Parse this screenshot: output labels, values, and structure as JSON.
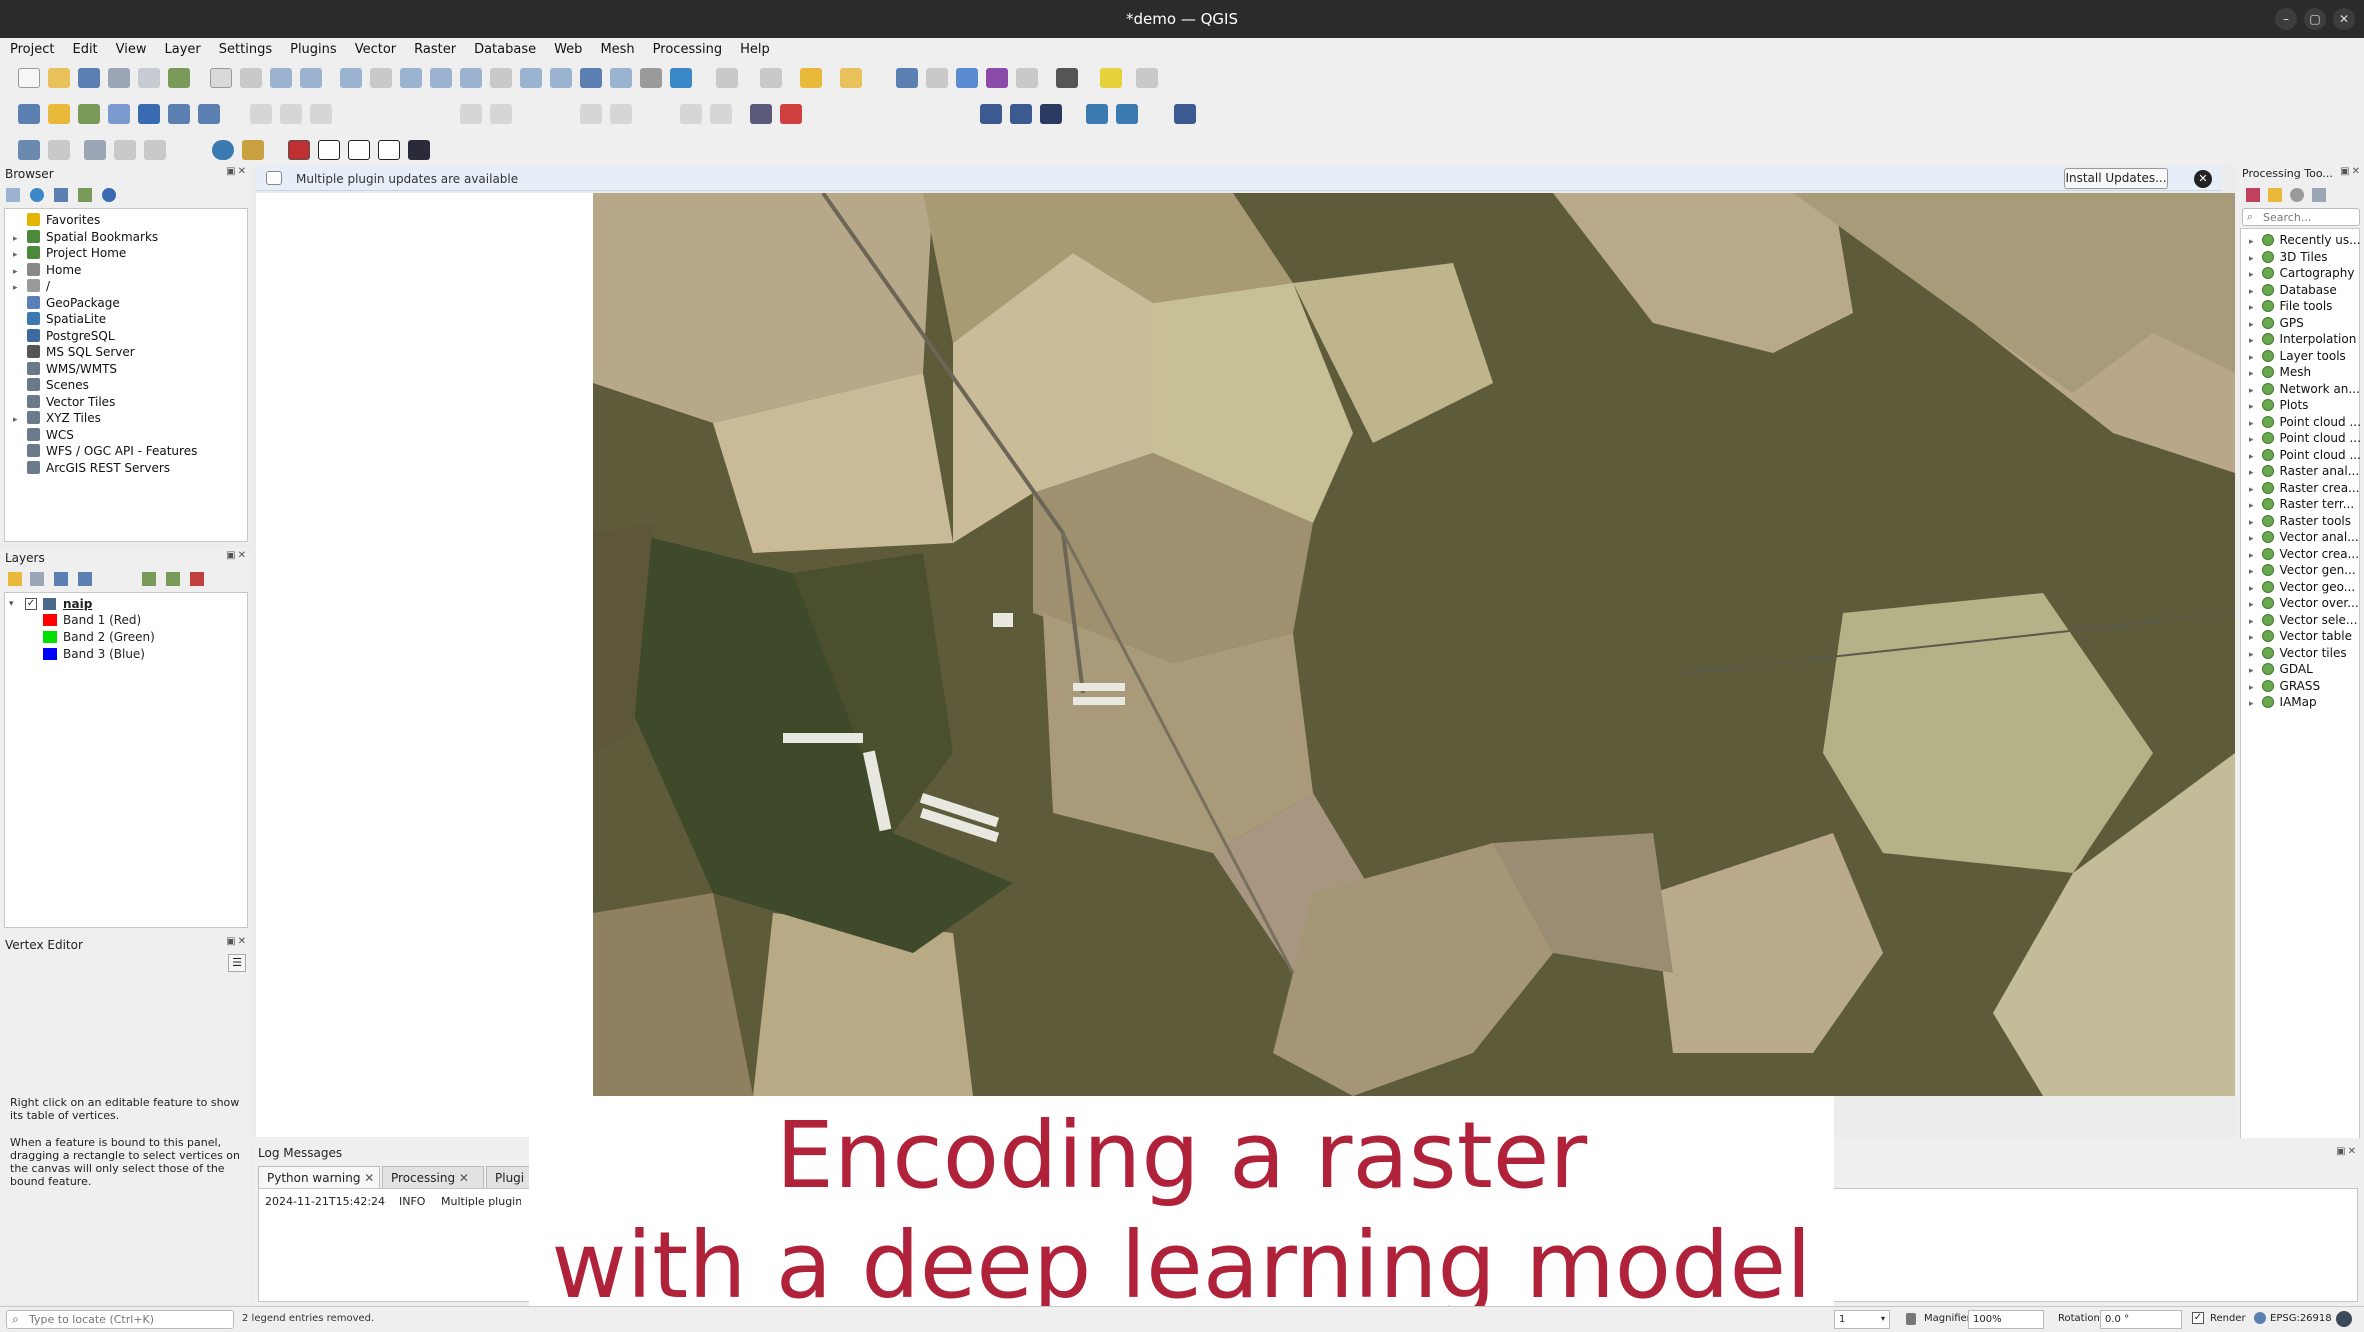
{
  "window": {
    "title": "*demo — QGIS",
    "controls": [
      "–",
      "▢",
      "✕"
    ]
  },
  "menu": [
    "Project",
    "Edit",
    "View",
    "Layer",
    "Settings",
    "Plugins",
    "Vector",
    "Raster",
    "Database",
    "Web",
    "Mesh",
    "Processing",
    "Help"
  ],
  "browser": {
    "title": "Browser",
    "items": [
      {
        "label": "Favorites",
        "arrow": "",
        "icon": "star-icon",
        "color": "#e5b400"
      },
      {
        "label": "Spatial Bookmarks",
        "arrow": "▸",
        "icon": "bookmark-icon",
        "color": "#4a8a3a"
      },
      {
        "label": "Project Home",
        "arrow": "▸",
        "icon": "project-home-icon",
        "color": "#4a8a3a"
      },
      {
        "label": "Home",
        "arrow": "▸",
        "icon": "home-icon",
        "color": "#888888"
      },
      {
        "label": "/",
        "arrow": "▸",
        "icon": "folder-icon",
        "color": "#9a9a9a"
      },
      {
        "label": "GeoPackage",
        "arrow": "",
        "icon": "geopackage-icon",
        "color": "#5b7fb8"
      },
      {
        "label": "SpatiaLite",
        "arrow": "",
        "icon": "spatialite-icon",
        "color": "#3a7ab0"
      },
      {
        "label": "PostgreSQL",
        "arrow": "",
        "icon": "postgresql-icon",
        "color": "#3c6aa0"
      },
      {
        "label": "MS SQL Server",
        "arrow": "",
        "icon": "mssql-icon",
        "color": "#555555"
      },
      {
        "label": "WMS/WMTS",
        "arrow": "",
        "icon": "wms-icon",
        "color": "#6a7a8a"
      },
      {
        "label": "Scenes",
        "arrow": "",
        "icon": "scenes-icon",
        "color": "#6a7a8a"
      },
      {
        "label": "Vector Tiles",
        "arrow": "",
        "icon": "vector-tiles-icon",
        "color": "#6a7a8a"
      },
      {
        "label": "XYZ Tiles",
        "arrow": "▸",
        "icon": "xyz-tiles-icon",
        "color": "#6a7a8a"
      },
      {
        "label": "WCS",
        "arrow": "",
        "icon": "wcs-icon",
        "color": "#6a7a8a"
      },
      {
        "label": "WFS / OGC API - Features",
        "arrow": "",
        "icon": "wfs-icon",
        "color": "#6a7a8a"
      },
      {
        "label": "ArcGIS REST Servers",
        "arrow": "",
        "icon": "arcgis-icon",
        "color": "#6a7a8a"
      }
    ]
  },
  "layers": {
    "title": "Layers",
    "layer_name": "naip",
    "bands": [
      {
        "label": "Band 1 (Red)",
        "color": "#ff0000"
      },
      {
        "label": "Band 2 (Green)",
        "color": "#00e000"
      },
      {
        "label": "Band 3 (Blue)",
        "color": "#0000ff"
      }
    ]
  },
  "vertex_editor": {
    "title": "Vertex Editor",
    "help1": "Right click on an editable feature to show its table of vertices.",
    "help2": "When a feature is bound to this panel, dragging a rectangle to select vertices on the canvas will only select those of the bound feature."
  },
  "notice": {
    "text": "Multiple plugin updates are available",
    "button": "Install Updates..."
  },
  "log": {
    "title": "Log Messages",
    "tabs": [
      "Python warning",
      "Processing",
      "Plugi"
    ],
    "row": {
      "time": "2024-11-21T15:42:24",
      "level": "INFO",
      "message": "Multiple plugin u"
    }
  },
  "processing": {
    "title": "Processing Too...",
    "search_placeholder": "Search...",
    "items": [
      "Recently us...",
      "3D Tiles",
      "Cartography",
      "Database",
      "File tools",
      "GPS",
      "Interpolation",
      "Layer tools",
      "Mesh",
      "Network an...",
      "Plots",
      "Point cloud ...",
      "Point cloud ...",
      "Point cloud ...",
      "Raster anal...",
      "Raster crea...",
      "Raster terr...",
      "Raster tools",
      "Vector anal...",
      "Vector crea...",
      "Vector gen...",
      "Vector geo...",
      "Vector over...",
      "Vector sele...",
      "Vector table",
      "Vector tiles",
      "GDAL",
      "GRASS",
      "IAMap"
    ]
  },
  "overlay": {
    "line1": "Encoding a raster",
    "line2": "with a deep learning model"
  },
  "status": {
    "locate_placeholder": "Type to locate (Ctrl+K)",
    "message": "2 legend entries removed.",
    "scale": "1",
    "magnifier_label": "Magnifier",
    "magnifier_value": "100%",
    "rotation_label": "Rotation",
    "rotation_value": "0.0 °",
    "render_label": "Render",
    "crs": "EPSG:26918"
  }
}
